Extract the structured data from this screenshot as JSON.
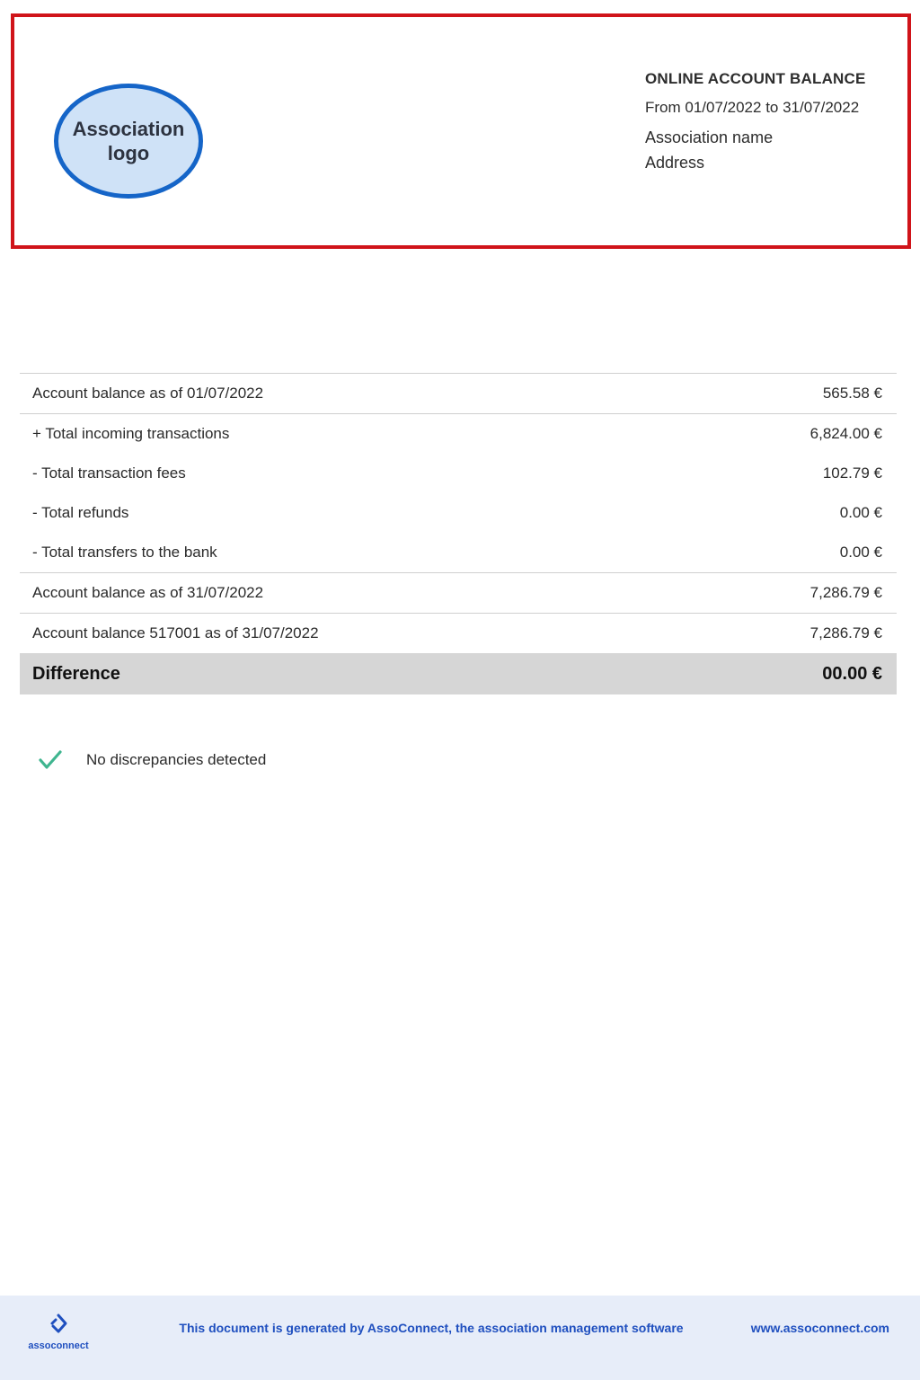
{
  "header": {
    "logo_label": "Association logo",
    "title": "ONLINE ACCOUNT BALANCE",
    "period": "From 01/07/2022 to 31/07/2022",
    "association_name": "Association name",
    "address": "Address"
  },
  "table": {
    "rows": [
      {
        "label": "Account balance as of 01/07/2022",
        "amount": "565.58 €"
      },
      {
        "label": "+ Total incoming transactions",
        "amount": "6,824.00 €"
      },
      {
        "label": "- Total transaction fees",
        "amount": "102.79 €"
      },
      {
        "label": "- Total refunds",
        "amount": "0.00 €"
      },
      {
        "label": "- Total transfers to the bank",
        "amount": "0.00 €"
      },
      {
        "label": "Account balance as of 31/07/2022",
        "amount": "7,286.79 €"
      },
      {
        "label": "Account balance 517001 as of 31/07/2022",
        "amount": "7,286.79 €"
      }
    ],
    "difference": {
      "label": "Difference",
      "amount": "00.00 €"
    }
  },
  "status": {
    "text": "No discrepancies detected",
    "icon": "checkmark-icon",
    "color": "#3fb58f"
  },
  "footer": {
    "brand": "assoconnect",
    "text": "This document is generated by AssoConnect, the association management software",
    "url": "www.assoconnect.com"
  },
  "colors": {
    "header_border": "#d0141a",
    "logo_border": "#1565c8",
    "logo_fill": "#cfe2f7",
    "footer_background": "#e7edf9",
    "footer_text": "#1f4fbf",
    "difference_background": "#d6d6d6"
  }
}
